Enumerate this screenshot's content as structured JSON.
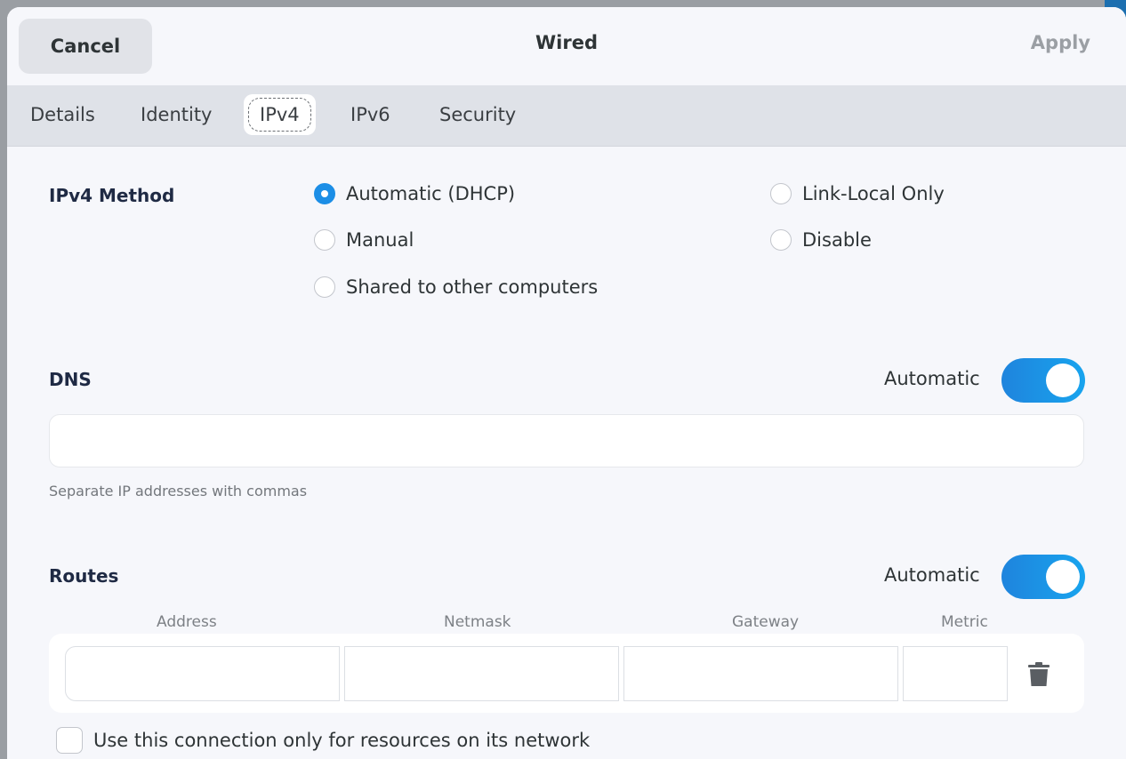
{
  "header": {
    "cancel_label": "Cancel",
    "title": "Wired",
    "apply_label": "Apply"
  },
  "tabs": [
    {
      "label": "Details"
    },
    {
      "label": "Identity"
    },
    {
      "label": "IPv4",
      "active": true
    },
    {
      "label": "IPv6"
    },
    {
      "label": "Security"
    }
  ],
  "ipv4_method": {
    "label": "IPv4 Method",
    "options": [
      {
        "label": "Automatic (DHCP)",
        "checked": true
      },
      {
        "label": "Link-Local Only",
        "checked": false
      },
      {
        "label": "Manual",
        "checked": false
      },
      {
        "label": "Disable",
        "checked": false
      },
      {
        "label": "Shared to other computers",
        "checked": false
      }
    ]
  },
  "dns": {
    "label": "DNS",
    "automatic_label": "Automatic",
    "automatic_on": true,
    "value": "",
    "hint": "Separate IP addresses with commas"
  },
  "routes": {
    "label": "Routes",
    "automatic_label": "Automatic",
    "automatic_on": true,
    "columns": [
      "Address",
      "Netmask",
      "Gateway",
      "Metric"
    ],
    "row": {
      "address": "",
      "netmask": "",
      "gateway": "",
      "metric": ""
    },
    "only_resources_label": "Use this connection only for resources on its network",
    "only_resources_checked": false
  },
  "colors": {
    "accent": "#1c8ee6",
    "toggle_on": "#1f84dd",
    "dialog_bg": "#f6f7fb",
    "tabbar_bg": "#dfe2e8"
  },
  "icons": {
    "trash": "trash-icon"
  }
}
